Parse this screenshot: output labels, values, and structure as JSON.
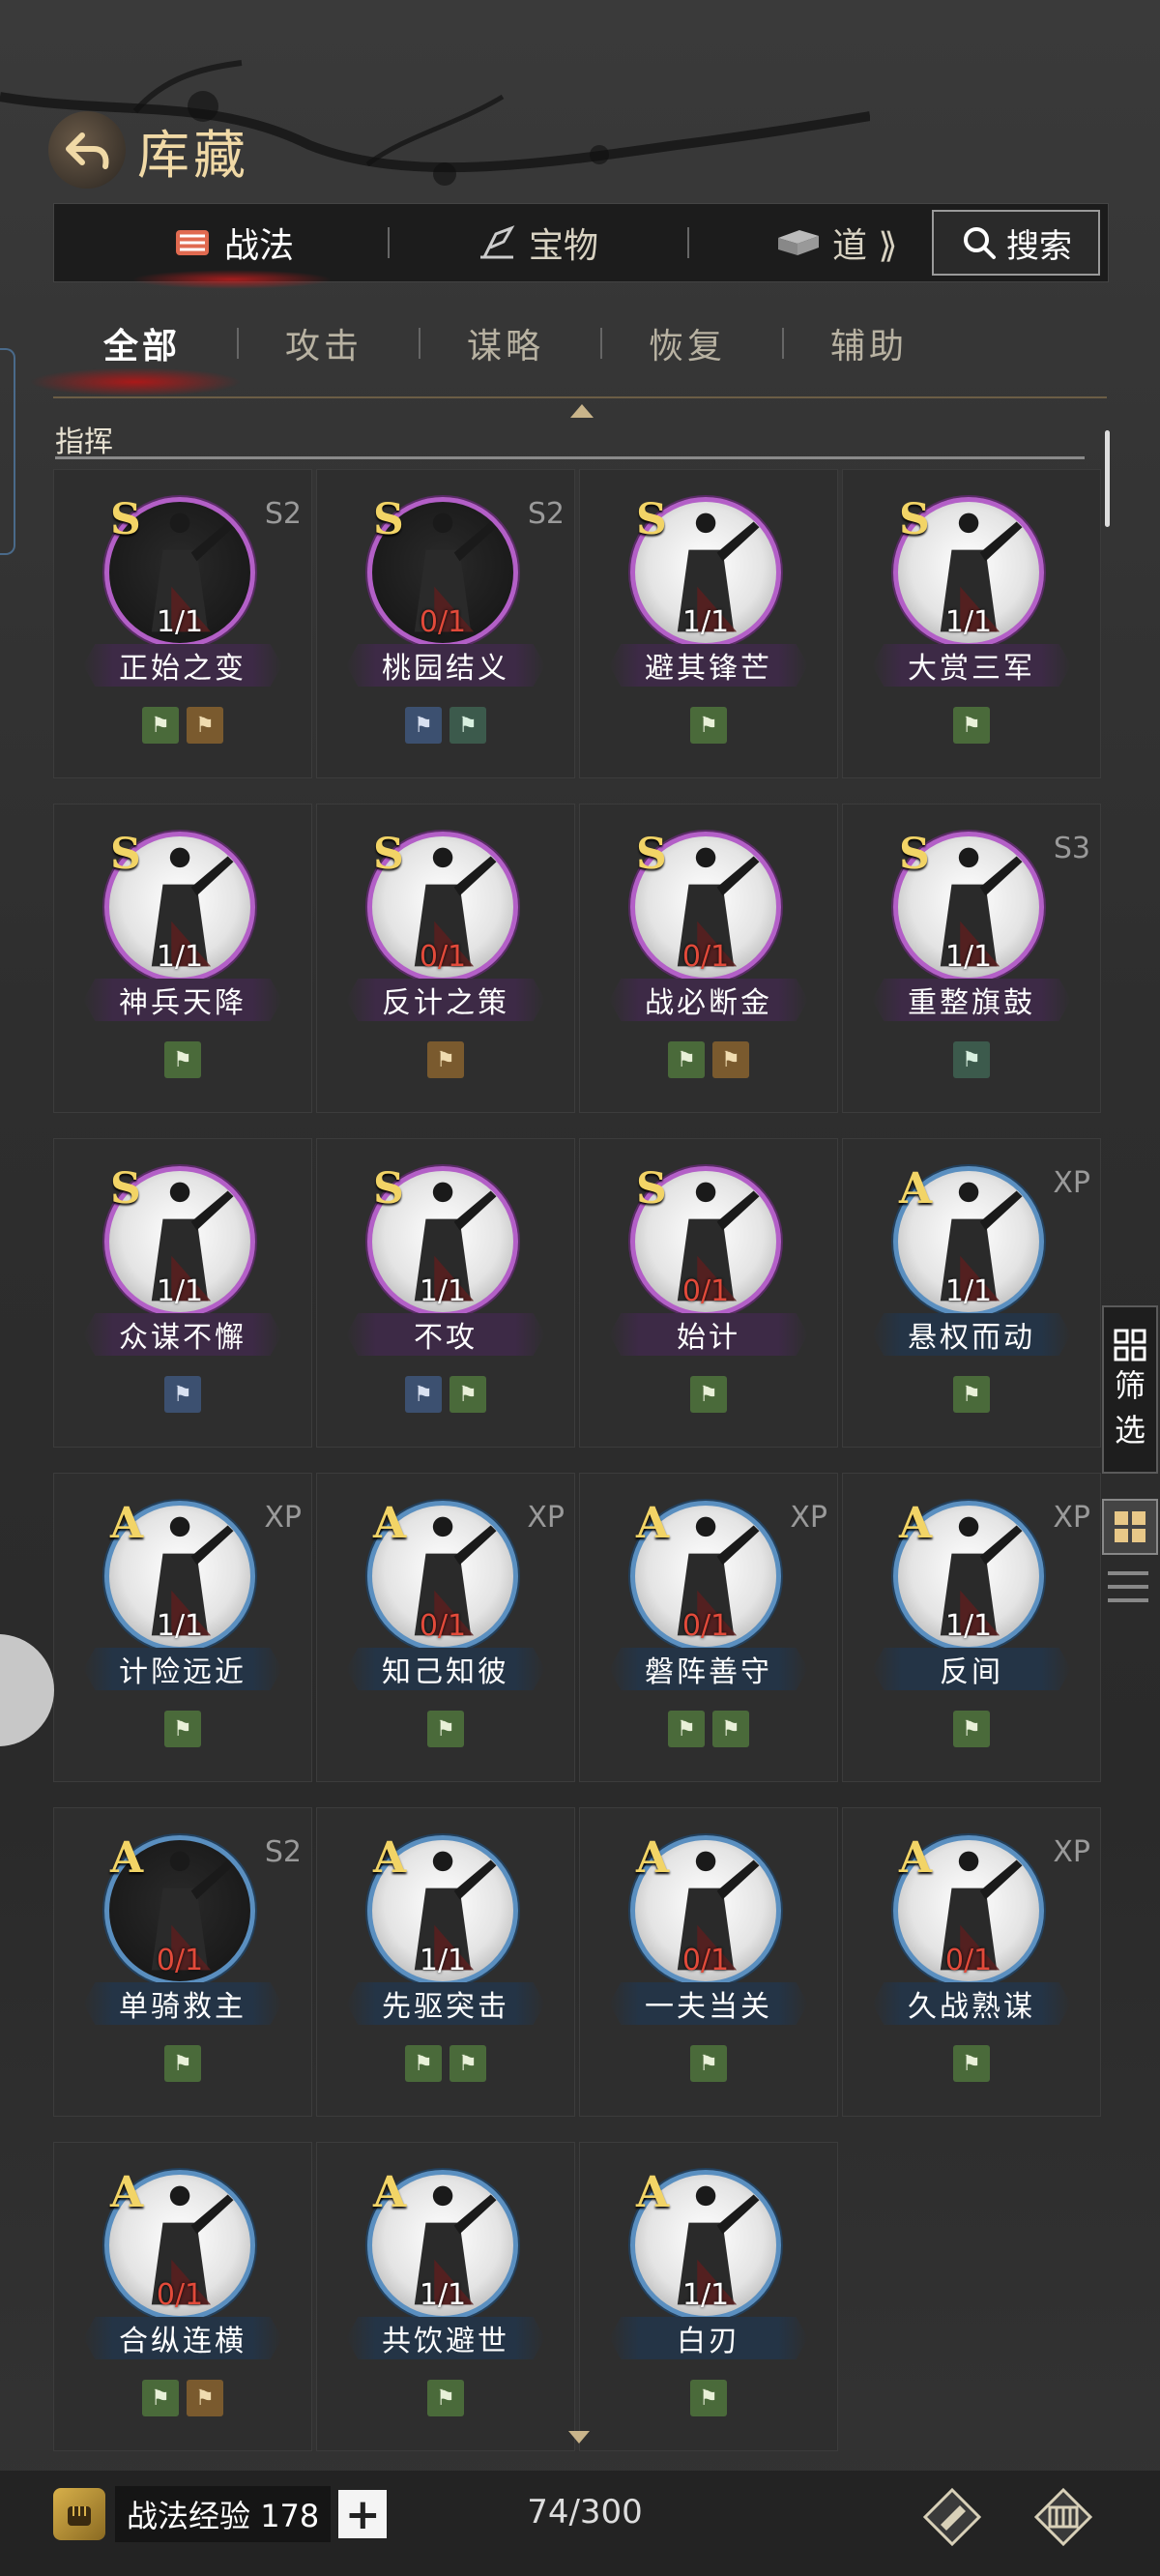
{
  "header": {
    "title": "库藏",
    "back_icon": "back-arrow-icon"
  },
  "top_tabs": [
    {
      "label": "战法",
      "icon": "scroll-icon",
      "active": true
    },
    {
      "label": "宝物",
      "icon": "treasure-icon",
      "active": false
    },
    {
      "label": "道 ⟫",
      "icon": "item-icon",
      "active": false
    }
  ],
  "search": {
    "label": "搜索",
    "icon": "search-icon"
  },
  "sub_tabs": [
    {
      "label": "全部",
      "active": true
    },
    {
      "label": "攻击",
      "active": false
    },
    {
      "label": "谋略",
      "active": false
    },
    {
      "label": "恢复",
      "active": false
    },
    {
      "label": "辅助",
      "active": false
    }
  ],
  "section_title": "指挥",
  "side": {
    "filter_label_1": "筛",
    "filter_label_2": "选"
  },
  "skills": [
    {
      "name": "正始之变",
      "grade": "S",
      "season": "S2",
      "count": "1/1",
      "zero": false,
      "dark": true,
      "tags": [
        "green",
        "brown"
      ]
    },
    {
      "name": "桃园结义",
      "grade": "S",
      "season": "S2",
      "count": "0/1",
      "zero": true,
      "dark": true,
      "tags": [
        "blue",
        "teal"
      ]
    },
    {
      "name": "避其锋芒",
      "grade": "S",
      "season": "",
      "count": "1/1",
      "zero": false,
      "dark": false,
      "tags": [
        "green"
      ]
    },
    {
      "name": "大赏三军",
      "grade": "S",
      "season": "",
      "count": "1/1",
      "zero": false,
      "dark": false,
      "tags": [
        "green"
      ]
    },
    {
      "name": "神兵天降",
      "grade": "S",
      "season": "",
      "count": "1/1",
      "zero": false,
      "dark": false,
      "tags": [
        "green"
      ]
    },
    {
      "name": "反计之策",
      "grade": "S",
      "season": "",
      "count": "0/1",
      "zero": true,
      "dark": false,
      "tags": [
        "brown"
      ]
    },
    {
      "name": "战必断金",
      "grade": "S",
      "season": "",
      "count": "0/1",
      "zero": true,
      "dark": false,
      "tags": [
        "green",
        "brown"
      ]
    },
    {
      "name": "重整旗鼓",
      "grade": "S",
      "season": "S3",
      "count": "1/1",
      "zero": false,
      "dark": false,
      "tags": [
        "teal"
      ]
    },
    {
      "name": "众谋不懈",
      "grade": "S",
      "season": "",
      "count": "1/1",
      "zero": false,
      "dark": false,
      "tags": [
        "blue"
      ]
    },
    {
      "name": "不攻",
      "grade": "S",
      "season": "",
      "count": "1/1",
      "zero": false,
      "dark": false,
      "tags": [
        "blue",
        "green"
      ]
    },
    {
      "name": "始计",
      "grade": "S",
      "season": "",
      "count": "0/1",
      "zero": true,
      "dark": false,
      "tags": [
        "green"
      ]
    },
    {
      "name": "悬权而动",
      "grade": "A",
      "season": "XP",
      "count": "1/1",
      "zero": false,
      "dark": false,
      "tags": [
        "green"
      ]
    },
    {
      "name": "计险远近",
      "grade": "A",
      "season": "XP",
      "count": "1/1",
      "zero": false,
      "dark": false,
      "tags": [
        "green"
      ]
    },
    {
      "name": "知己知彼",
      "grade": "A",
      "season": "XP",
      "count": "0/1",
      "zero": true,
      "dark": false,
      "tags": [
        "green"
      ]
    },
    {
      "name": "磐阵善守",
      "grade": "A",
      "season": "XP",
      "count": "0/1",
      "zero": true,
      "dark": false,
      "tags": [
        "green",
        "green"
      ]
    },
    {
      "name": "反间",
      "grade": "A",
      "season": "XP",
      "count": "1/1",
      "zero": false,
      "dark": false,
      "tags": [
        "green"
      ]
    },
    {
      "name": "单骑救主",
      "grade": "A",
      "season": "S2",
      "count": "0/1",
      "zero": true,
      "dark": true,
      "tags": [
        "green"
      ]
    },
    {
      "name": "先驱突击",
      "grade": "A",
      "season": "",
      "count": "1/1",
      "zero": false,
      "dark": false,
      "tags": [
        "green",
        "green"
      ]
    },
    {
      "name": "一夫当关",
      "grade": "A",
      "season": "",
      "count": "0/1",
      "zero": true,
      "dark": false,
      "tags": [
        "green"
      ]
    },
    {
      "name": "久战熟谋",
      "grade": "A",
      "season": "XP",
      "count": "0/1",
      "zero": true,
      "dark": false,
      "tags": [
        "green"
      ]
    },
    {
      "name": "合纵连横",
      "grade": "A",
      "season": "",
      "count": "0/1",
      "zero": true,
      "dark": false,
      "tags": [
        "green",
        "brown"
      ]
    },
    {
      "name": "共饮避世",
      "grade": "A",
      "season": "",
      "count": "1/1",
      "zero": false,
      "dark": false,
      "tags": [
        "green"
      ]
    },
    {
      "name": "白刃",
      "grade": "A",
      "season": "",
      "count": "1/1",
      "zero": false,
      "dark": false,
      "tags": [
        "green"
      ]
    }
  ],
  "footer": {
    "exp_label": "战法经验",
    "exp_value": "178",
    "plus_label": "+",
    "capacity": "74/300"
  }
}
